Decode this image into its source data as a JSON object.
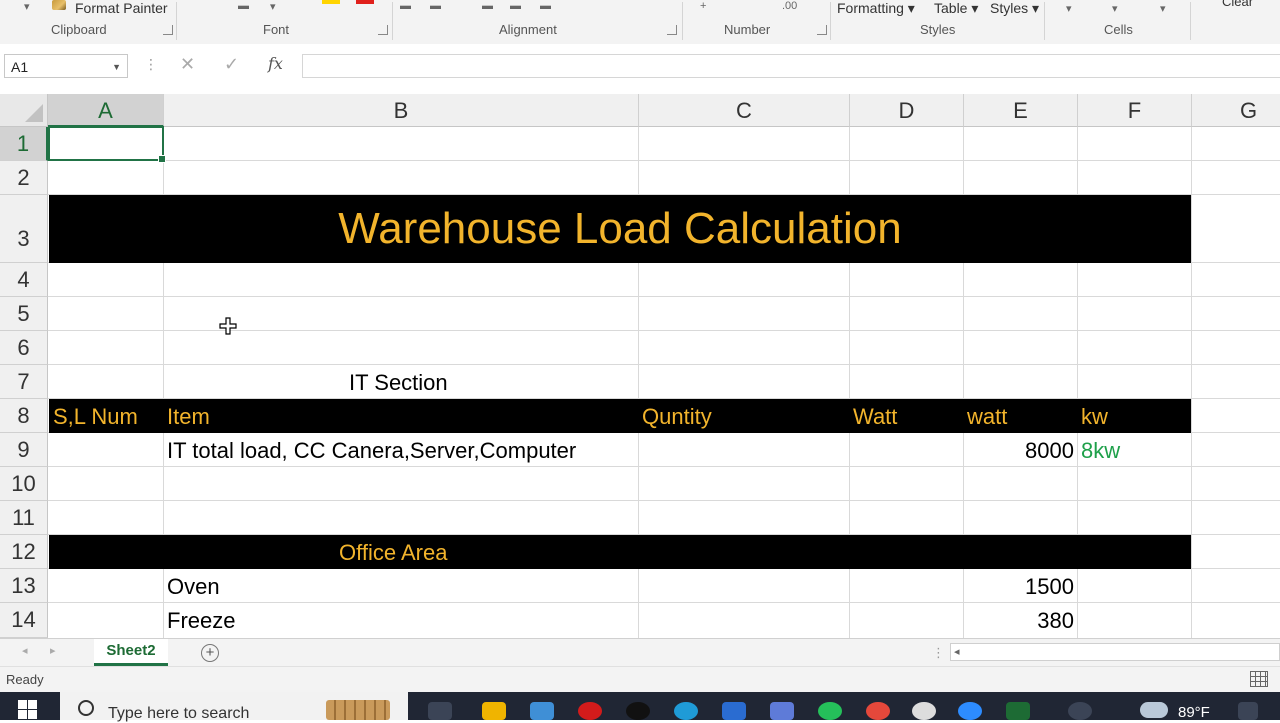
{
  "ribbon": {
    "format_painter": "Format Painter",
    "cond_formatting": "Formatting",
    "format_table": "Table",
    "cell_styles": "Styles",
    "clear": "Clear",
    "groups": {
      "clipboard": "Clipboard",
      "font": "Font",
      "alignment": "Alignment",
      "number": "Number",
      "styles": "Styles",
      "cells": "Cells"
    }
  },
  "formula_bar": {
    "name_box": "A1",
    "fx": "fx",
    "value": ""
  },
  "columns": [
    "A",
    "B",
    "C",
    "D",
    "E",
    "F",
    "G"
  ],
  "rows": [
    "1",
    "2",
    "3",
    "4",
    "5",
    "6",
    "7",
    "8",
    "9",
    "10",
    "11",
    "12",
    "13",
    "14"
  ],
  "sheet": {
    "title": "Warehouse Load Calculation",
    "it_section": "IT Section",
    "headers": {
      "sl": "S,L Num",
      "item": "Item",
      "quantity": "Quntity",
      "watt": "Watt",
      "watt2": "watt",
      "kw": "kw"
    },
    "it_row": {
      "item": "IT total load, CC Canera,Server,Computer",
      "watt": "8000",
      "kw": "8kw"
    },
    "office_area": "Office Area",
    "office_rows": [
      {
        "item": "Oven",
        "watt": "1500"
      },
      {
        "item": "Freeze",
        "watt": "380"
      }
    ]
  },
  "tabs": {
    "active": "Sheet2"
  },
  "status": {
    "text": "Ready"
  },
  "taskbar": {
    "search_placeholder": "Type here to search",
    "temperature": "89°F"
  },
  "colors": {
    "accent": "#217346",
    "title_text": "#f2b42c",
    "band": "#000000",
    "kw_text": "#1ea04a"
  }
}
